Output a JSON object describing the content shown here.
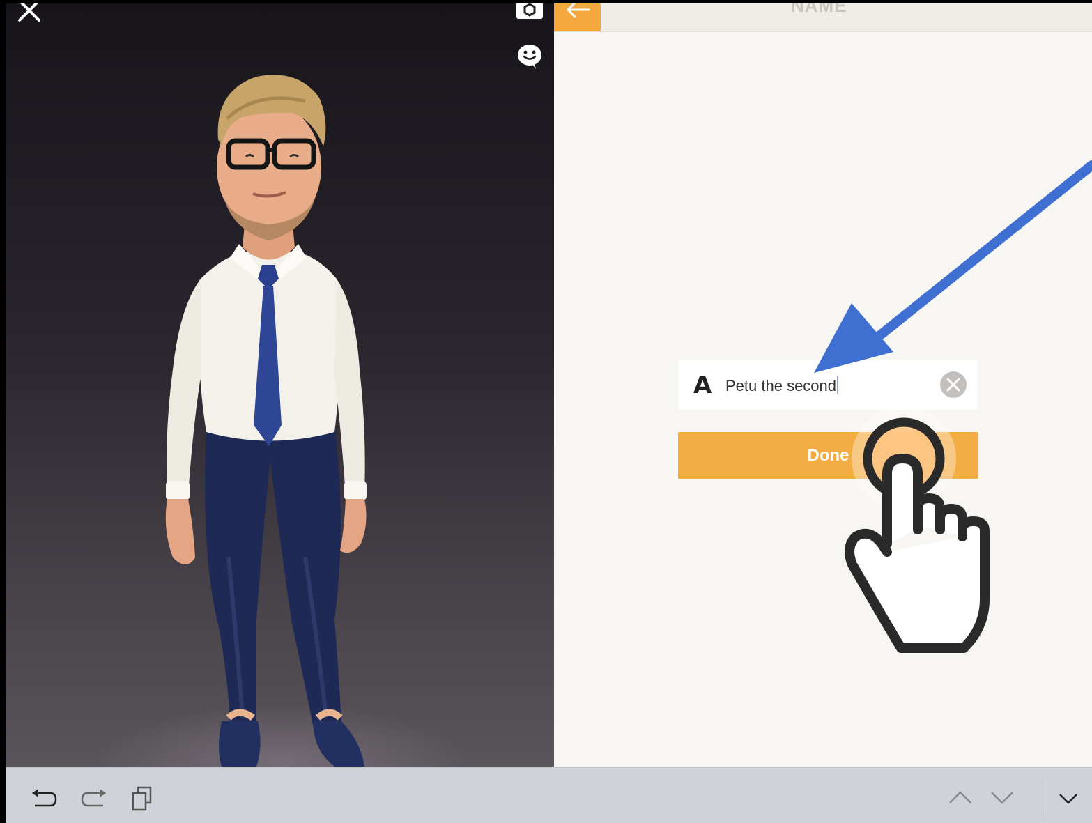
{
  "header": {
    "title": "NAME"
  },
  "name_input": {
    "value": "Petu the second"
  },
  "done_button": {
    "label": "Done"
  },
  "icons": {
    "close": "close-icon",
    "camera": "camera-icon",
    "emoji": "emoji-chat-icon",
    "back": "back-arrow-icon",
    "font": "font-a-icon",
    "clear": "clear-icon",
    "undo": "undo-icon",
    "redo": "redo-icon",
    "clipboard": "clipboard-icon",
    "prev": "chevron-up-icon",
    "next": "chevron-down-icon",
    "dismiss": "dismiss-keyboard-icon"
  },
  "colors": {
    "accent": "#f4ad44",
    "annotation_arrow": "#3f6fd1",
    "toolbar": "#cfd2d8"
  }
}
